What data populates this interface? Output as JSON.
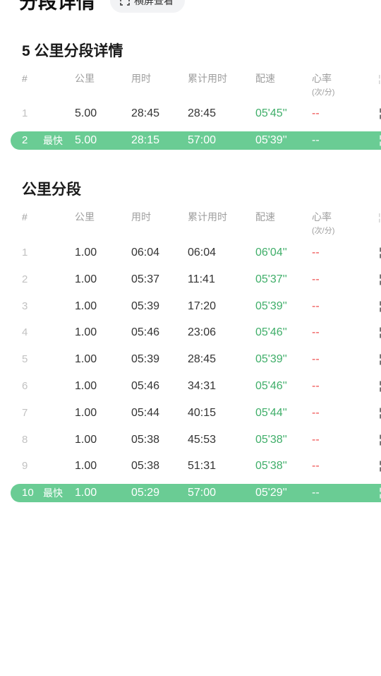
{
  "header": {
    "title": "分段详情",
    "rotate_label": "横屏查看"
  },
  "columns": {
    "index": "#",
    "distance": "公里",
    "time": "用时",
    "cumulative": "累计用时",
    "pace": "配速",
    "heart_rate": "心率",
    "heart_rate_unit": "(次/分)"
  },
  "section_5km": {
    "title": "5 公里分段详情",
    "rows": [
      {
        "index": "1",
        "distance": "5.00",
        "time": "28:45",
        "cumulative": "28:45",
        "pace": "05'45''",
        "hr": "--",
        "best": false,
        "tag": ""
      },
      {
        "index": "2",
        "distance": "5.00",
        "time": "28:15",
        "cumulative": "57:00",
        "pace": "05'39''",
        "hr": "--",
        "best": true,
        "tag": "最快"
      }
    ]
  },
  "section_1km": {
    "title": "公里分段",
    "rows": [
      {
        "index": "1",
        "distance": "1.00",
        "time": "06:04",
        "cumulative": "06:04",
        "pace": "06'04''",
        "hr": "--",
        "best": false,
        "tag": ""
      },
      {
        "index": "2",
        "distance": "1.00",
        "time": "05:37",
        "cumulative": "11:41",
        "pace": "05'37''",
        "hr": "--",
        "best": false,
        "tag": ""
      },
      {
        "index": "3",
        "distance": "1.00",
        "time": "05:39",
        "cumulative": "17:20",
        "pace": "05'39''",
        "hr": "--",
        "best": false,
        "tag": ""
      },
      {
        "index": "4",
        "distance": "1.00",
        "time": "05:46",
        "cumulative": "23:06",
        "pace": "05'46''",
        "hr": "--",
        "best": false,
        "tag": ""
      },
      {
        "index": "5",
        "distance": "1.00",
        "time": "05:39",
        "cumulative": "28:45",
        "pace": "05'39''",
        "hr": "--",
        "best": false,
        "tag": ""
      },
      {
        "index": "6",
        "distance": "1.00",
        "time": "05:46",
        "cumulative": "34:31",
        "pace": "05'46''",
        "hr": "--",
        "best": false,
        "tag": ""
      },
      {
        "index": "7",
        "distance": "1.00",
        "time": "05:44",
        "cumulative": "40:15",
        "pace": "05'44''",
        "hr": "--",
        "best": false,
        "tag": ""
      },
      {
        "index": "8",
        "distance": "1.00",
        "time": "05:38",
        "cumulative": "45:53",
        "pace": "05'38''",
        "hr": "--",
        "best": false,
        "tag": ""
      },
      {
        "index": "9",
        "distance": "1.00",
        "time": "05:38",
        "cumulative": "51:31",
        "pace": "05'38''",
        "hr": "--",
        "best": false,
        "tag": ""
      },
      {
        "index": "10",
        "distance": "1.00",
        "time": "05:29",
        "cumulative": "57:00",
        "pace": "05'29''",
        "hr": "--",
        "best": true,
        "tag": "最快"
      }
    ]
  },
  "colors": {
    "pace_green": "#3fae69",
    "best_row_bg": "#6acc94",
    "heart_rate_red": "#ef4d4d"
  }
}
